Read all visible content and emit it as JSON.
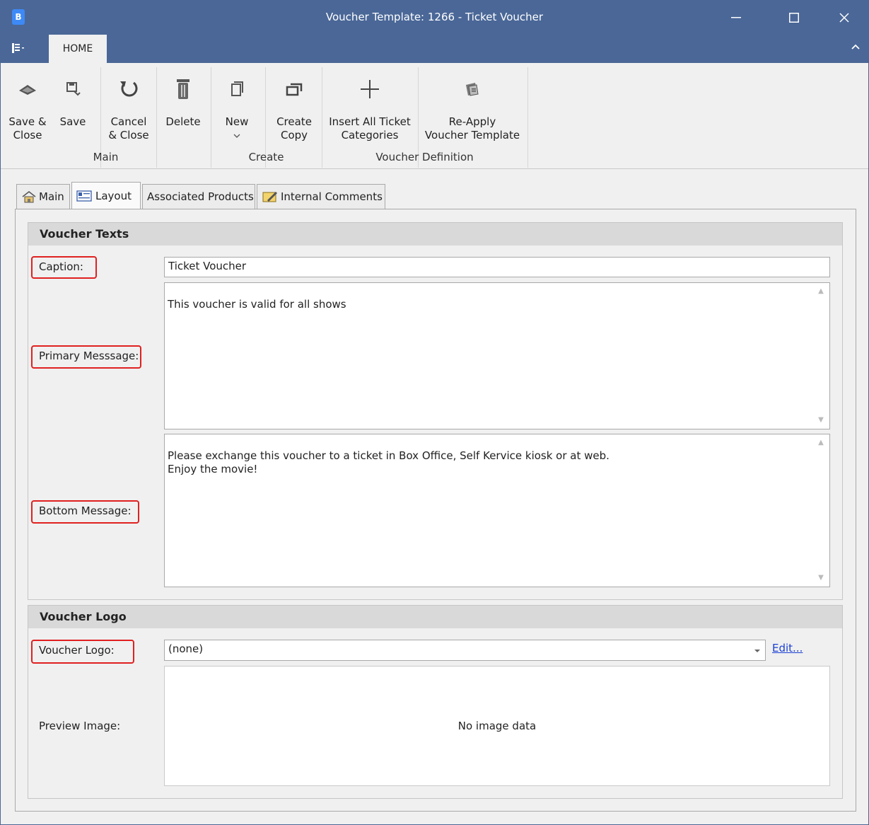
{
  "window": {
    "title": "Voucher Template: 1266 - Ticket Voucher",
    "app_icon_letter": "B"
  },
  "ribbon": {
    "tab_home": "HOME",
    "buttons": {
      "save_close": "Save &\nClose",
      "save": "Save",
      "cancel_close": "Cancel\n& Close",
      "delete": "Delete",
      "new": "New",
      "create_copy": "Create\nCopy",
      "insert_all": "Insert All Ticket\nCategories",
      "reapply": "Re-Apply\nVoucher Template"
    },
    "groups": {
      "main": "Main",
      "create": "Create",
      "voucher_definition": "Voucher Definition"
    }
  },
  "tabs": {
    "main": "Main",
    "layout": "Layout",
    "associated_products": "Associated Products",
    "internal_comments": "Internal Comments"
  },
  "voucher_texts": {
    "header": "Voucher Texts",
    "caption_label": "Caption:",
    "caption_value": "Ticket Voucher",
    "primary_label": "Primary Messsage:",
    "primary_value": "This voucher is valid for all shows",
    "bottom_label": "Bottom Message:",
    "bottom_value": "Please exchange this voucher to a ticket in Box Office, Self Kervice kiosk or at web.\nEnjoy the movie!"
  },
  "voucher_logo": {
    "header": "Voucher Logo",
    "logo_label": "Voucher Logo:",
    "logo_value": "(none)",
    "edit_link": "Edit...",
    "preview_label": "Preview Image:",
    "preview_text": "No image data"
  },
  "colors": {
    "titlebar": "#4a6797",
    "highlight": "#e02020",
    "link": "#1a3fd4"
  }
}
